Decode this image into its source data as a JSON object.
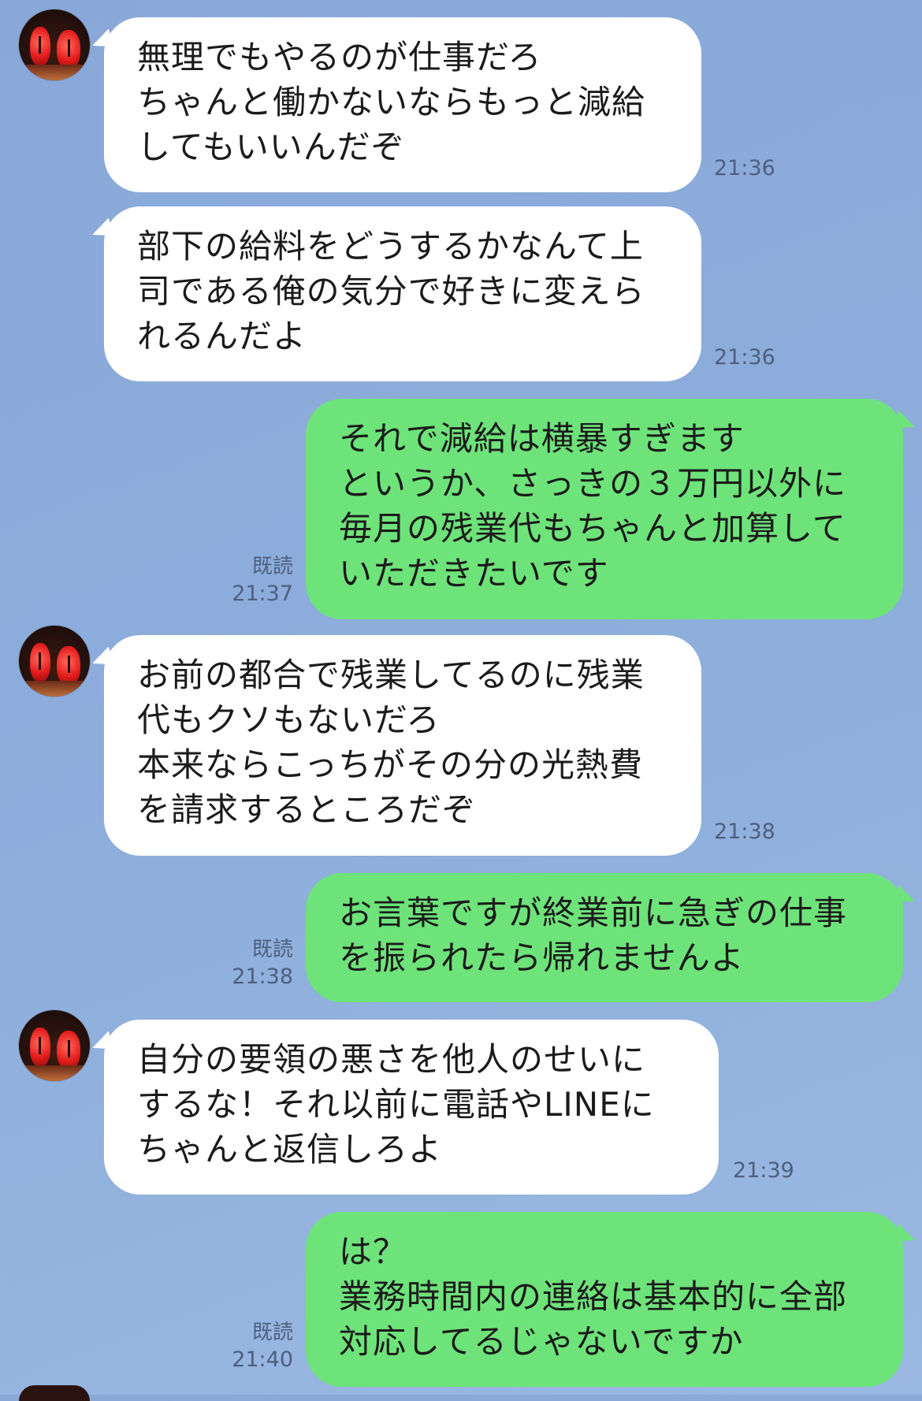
{
  "chat": {
    "messages": [
      {
        "sender": "other",
        "lines": [
          "無理でもやるのが仕事だろ",
          "ちゃんと働かないならもっと減給",
          "してもいいんだぞ"
        ],
        "time": "21:36"
      },
      {
        "sender": "other",
        "lines": [
          "部下の給料をどうするかなんて上",
          "司である俺の気分で好きに変えら",
          "れるんだよ"
        ],
        "time": "21:36"
      },
      {
        "sender": "me",
        "lines": [
          "それで減給は横暴すぎます",
          "というか、さっきの３万円以外に",
          "毎月の残業代もちゃんと加算して",
          "いただきたいです"
        ],
        "read": "既読",
        "time": "21:37"
      },
      {
        "sender": "other",
        "lines": [
          "お前の都合で残業してるのに残業",
          "代もクソもないだろ",
          "本来ならこっちがその分の光熱費",
          "を請求するところだぞ"
        ],
        "time": "21:38"
      },
      {
        "sender": "me",
        "lines": [
          "お言葉ですが終業前に急ぎの仕事",
          "を振られたら帰れませんよ"
        ],
        "read": "既読",
        "time": "21:38"
      },
      {
        "sender": "other",
        "lines": [
          "自分の要領の悪さを他人のせいに",
          "するな！それ以前に電話やLINEに",
          "ちゃんと返信しろよ"
        ],
        "time": "21:39"
      },
      {
        "sender": "me",
        "lines": [
          "は？",
          "業務時間内の連絡は基本的に全部",
          "対応してるじゃないですか"
        ],
        "read": "既読",
        "time": "21:40"
      }
    ]
  },
  "colors": {
    "background": "#8eaedc",
    "incoming_bubble": "#ffffff",
    "outgoing_bubble": "#6ee37a",
    "meta_text": "#4e5f7e"
  },
  "icons": {
    "avatar": "avatar-lanterns-icon"
  }
}
